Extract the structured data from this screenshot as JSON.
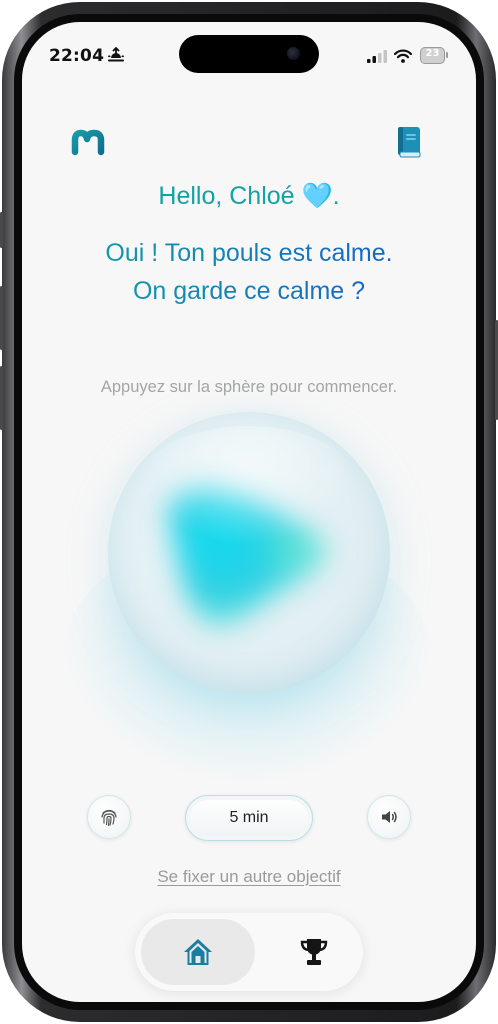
{
  "status_bar": {
    "time": "22:04",
    "battery": "23"
  },
  "header": {
    "logo_icon": "m-logo-icon",
    "journal_icon": "book-icon"
  },
  "greeting": "Hello, Chloé 🩵.",
  "message": "Oui ! Ton pouls est calme. On garde ce calme ?",
  "hint": "Appuyez sur la sphère pour commencer.",
  "controls": {
    "fingerprint_icon": "fingerprint-icon",
    "duration_label": "5 min",
    "sound_icon": "speaker-icon"
  },
  "goal_link": "Se fixer un autre objectif",
  "tabs": [
    {
      "name": "home",
      "icon": "home-icon",
      "active": true
    },
    {
      "name": "trophy",
      "icon": "trophy-icon",
      "active": false
    }
  ],
  "colors": {
    "accent_teal": "#13a3a3",
    "accent_blue": "#1763c7",
    "sphere_core": "#22d3e6",
    "icon_blue": "#1a7ea3"
  }
}
